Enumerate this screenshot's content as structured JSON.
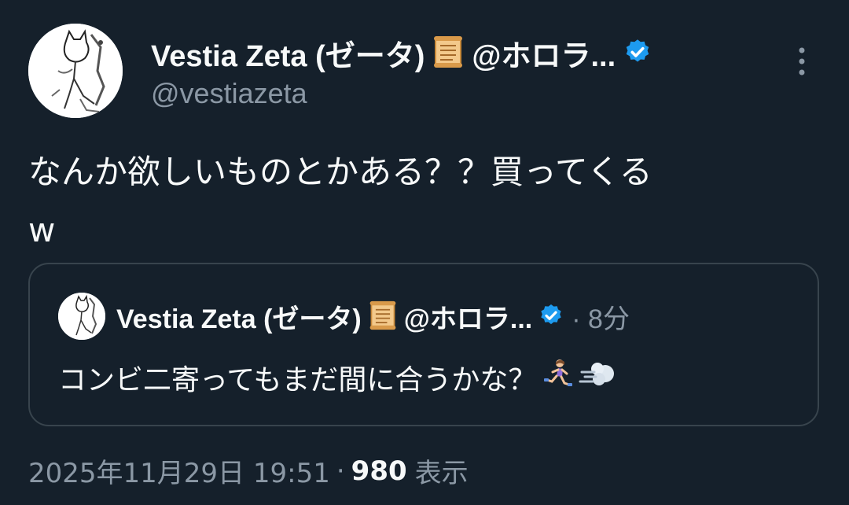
{
  "author": {
    "display_name": "Vestia Zeta (ゼータ)",
    "handle_truncated": "@ホロラ...",
    "username": "@vestiazeta"
  },
  "tweet": {
    "text": "なんか欲しいものとかある？？買ってくる\nw"
  },
  "quote": {
    "display_name": "Vestia Zeta (ゼータ)",
    "handle_truncated": "@ホロラ...",
    "separator": "·",
    "time": "8分",
    "text": "コンビ二寄ってもまだ間に合うかな？"
  },
  "meta": {
    "timestamp": "2025年11月29日 19:51",
    "separator": "·",
    "views_count": "980",
    "views_label": "表示"
  },
  "colors": {
    "background": "#15202b",
    "text_primary": "#f7f9f9",
    "text_secondary": "#8b98a5",
    "border": "#38444d",
    "verified_blue": "#1d9bf0"
  },
  "icons": {
    "verified": "verified-badge-icon",
    "scroll": "scroll-emoji-icon",
    "more": "more-vertical-icon",
    "runner": "woman-running-emoji-icon",
    "dash": "dash-emoji-icon"
  }
}
